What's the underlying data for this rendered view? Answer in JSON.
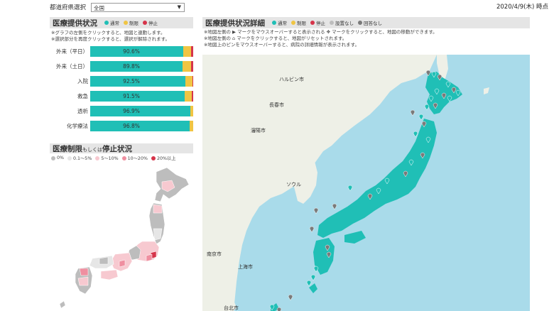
{
  "header": {
    "pref_label": "都道府県選択",
    "pref_value": "全国",
    "timestamp": "2020/4/9(木) 時点"
  },
  "colors": {
    "normal": "#20bfb6",
    "limited": "#f0c543",
    "stopped": "#d6344a",
    "not_set": "#bdbdbd",
    "no_answer": "#7a7a7a"
  },
  "status_panel": {
    "title": "医療提供状況",
    "legend": [
      "通常",
      "制限",
      "停止"
    ],
    "notes": [
      "※グラフの左側をクリックすると、地図と連動します。",
      "※選択部分を再度クリックすると、選択が解除されます。"
    ],
    "bars": [
      {
        "label": "外来（平日）",
        "value": "90.6%",
        "normal": 90.6,
        "limited": 7.4,
        "stopped": 2.0
      },
      {
        "label": "外来（土日）",
        "value": "89.8%",
        "normal": 89.8,
        "limited": 8.2,
        "stopped": 2.0
      },
      {
        "label": "入院",
        "value": "92.5%",
        "normal": 92.5,
        "limited": 6.5,
        "stopped": 1.0
      },
      {
        "label": "救急",
        "value": "91.5%",
        "normal": 91.5,
        "limited": 7.0,
        "stopped": 1.5
      },
      {
        "label": "透析",
        "value": "96.9%",
        "normal": 96.9,
        "limited": 3.1,
        "stopped": 0
      },
      {
        "label": "化学療法",
        "value": "96.8%",
        "normal": 96.8,
        "limited": 3.2,
        "stopped": 0
      }
    ]
  },
  "limit_panel": {
    "title": "医療制限",
    "title_small": "もしくは",
    "title_rest": "停止状況",
    "legend": [
      {
        "label": "0%",
        "color": "#bdbdbd"
      },
      {
        "label": "0.1～5%",
        "color": "#e6e6e6"
      },
      {
        "label": "5～10%",
        "color": "#f7c9d0"
      },
      {
        "label": "10～20%",
        "color": "#ef8fa0"
      },
      {
        "label": "20%以上",
        "color": "#d6344a"
      }
    ]
  },
  "detail_panel": {
    "title": "医療提供状況詳細",
    "legend": [
      "通常",
      "制限",
      "停止",
      "設置なし",
      "回答なし"
    ],
    "notes": [
      "※地図左側の ▶ マークをマウスオーバーすると表示される ✥ マークをクリックすると、地図の移動ができます。",
      "※地図左側の ⌂ マークをクリックすると、地図がリセットされます。",
      "※地図上のピンをマウスオーバーすると、病院の詳細情報が表示されます。"
    ],
    "map_labels": [
      "ハルビン市",
      "長春市",
      "瀋陽市",
      "ソウル",
      "南京市",
      "上海市",
      "台北市"
    ]
  }
}
